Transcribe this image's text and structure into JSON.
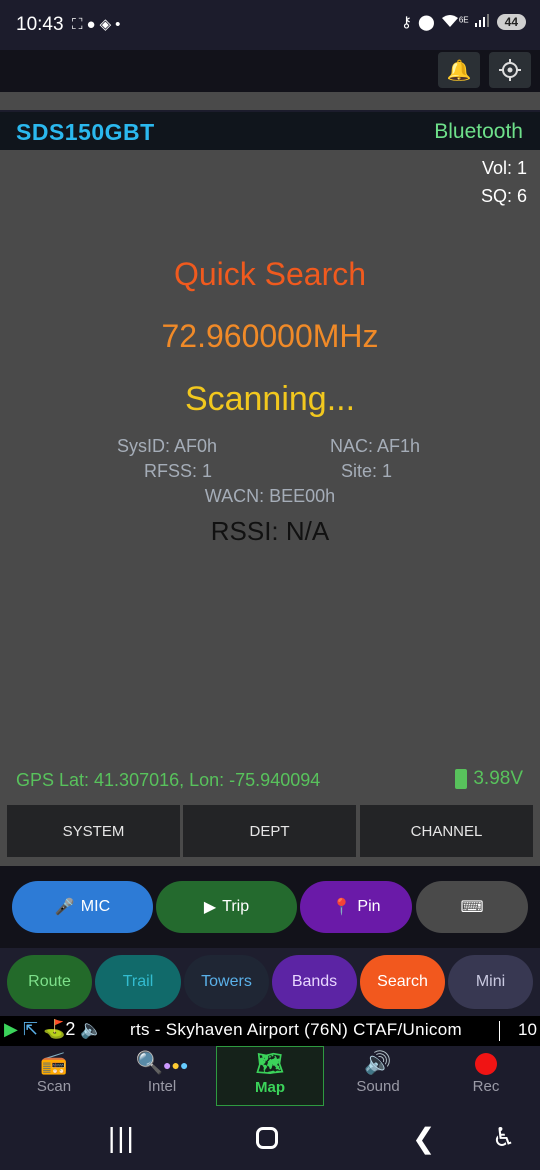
{
  "status_bar": {
    "time": "10:43",
    "left_icons": [
      "screenshot-icon",
      "chat-icon",
      "diamond-app-icon",
      "dot-icon"
    ],
    "right_icons": [
      "key-icon",
      "location-icon",
      "wifi-6e-icon",
      "signal-icon"
    ],
    "wifi_badge": "6E",
    "battery": "44"
  },
  "app_bar": {
    "icons": [
      "bell-icon",
      "gear-icon"
    ]
  },
  "device": {
    "name": "SDS150GBT",
    "connection": "Bluetooth",
    "connection_color": "#6ee08a"
  },
  "display": {
    "vol": "Vol: 1",
    "sq": "SQ: 6",
    "mode": "Quick Search",
    "frequency": "72.960000MHz",
    "state": "Scanning...",
    "sysid": "SysID: AF0h",
    "nac": "NAC: AF1h",
    "rfss": "RFSS: 1",
    "site": "Site: 1",
    "wacn": "WACN: BEE00h",
    "rssi": "RSSI: N/A",
    "gps": "GPS Lat: 41.307016, Lon: -75.940094",
    "battery_voltage": "3.98V",
    "colors": {
      "mode": "#f05a1e",
      "frequency": "#f08a28",
      "state": "#f2c81e"
    }
  },
  "tabs": {
    "system": "SYSTEM",
    "dept": "DEPT",
    "channel": "CHANNEL"
  },
  "actions": {
    "mic": "MIC",
    "trip": "Trip",
    "pin": "Pin",
    "keyboard_icon": "keyboard-icon"
  },
  "nav_pills": {
    "route": "Route",
    "trail": "Trail",
    "towers": "Towers",
    "bands": "Bands",
    "search": "Search",
    "mini": "Mini"
  },
  "ticker": {
    "count": "2",
    "text": "rts - Skyhaven Airport (76N) CTAF/Unicom",
    "right_text": "10"
  },
  "bottom_nav": {
    "scan": "Scan",
    "intel": "Intel",
    "map": "Map",
    "sound": "Sound",
    "rec": "Rec",
    "active": "Map"
  }
}
